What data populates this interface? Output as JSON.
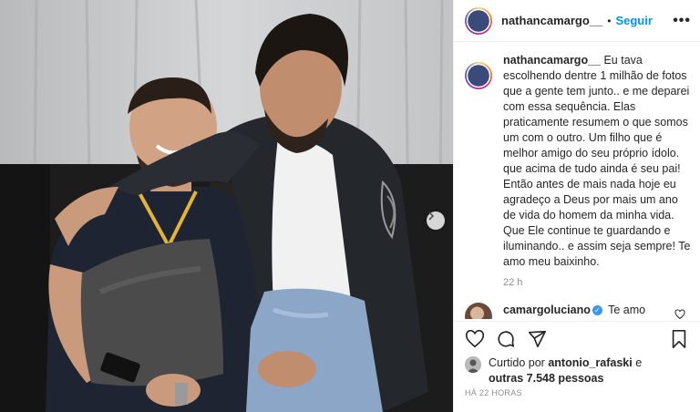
{
  "header": {
    "username": "nathancamargo__",
    "separator": "•",
    "follow_label": "Seguir",
    "more_label": "•••"
  },
  "caption": {
    "username": "nathancamargo__",
    "text": "Eu tava escolhendo dentre 1 milhão de fotos que a gente tem junto.. e me deparei com essa sequência. Elas praticamente resumem o que somos um com o outro. Um filho que é melhor amigo do seu próprio ídolo. que acima de tudo ainda é seu pai! Então antes de mais nada hoje eu agradeço a Deus por mais um ano de vida do homem da minha vida. Que Ele continue te guardando e iluminando.. e assim seja sempre! Te amo meu baixinho.",
    "time": "22 h"
  },
  "reply": {
    "username": "camargoluciano",
    "verified_mark": "✓",
    "text": "Te amo filhão!!!! Vem logo que o bolo já tá pronto 😄😄😄😄😄"
  },
  "likes": {
    "prefix": "Curtido por",
    "user": "antonio_rafaski",
    "connector": "e",
    "others": "outras 7.548 pessoas"
  },
  "posted_time": "HÁ 22 HORAS",
  "icons": [
    "heart-icon",
    "comment-icon",
    "share-icon",
    "bookmark-icon",
    "chevron-right-icon"
  ],
  "colors": {
    "follow": "#0095f6",
    "verified": "#3897f0",
    "muted": "#8e8e8e",
    "text": "#262626"
  }
}
